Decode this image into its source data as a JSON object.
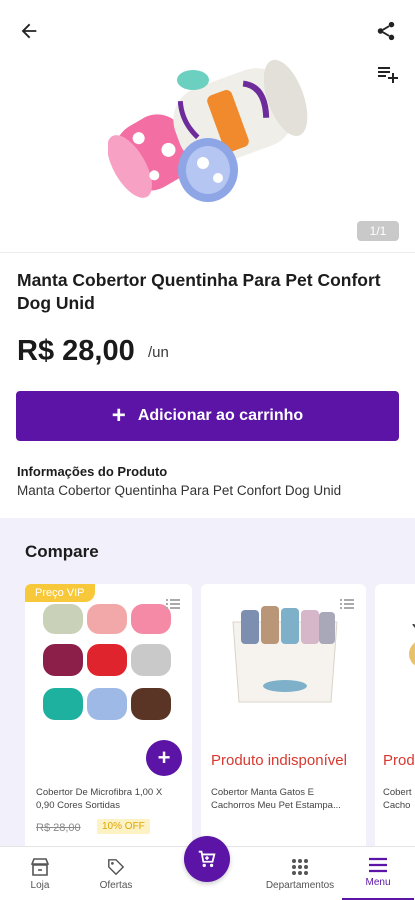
{
  "header": {
    "back_icon": "arrow-left-icon",
    "share_icon": "share-icon",
    "add_list_icon": "playlist-add-icon",
    "image_counter": "1/1"
  },
  "product": {
    "title": "Manta Cobertor Quentinha Para Pet Confort Dog Unid",
    "price": "R$ 28,00",
    "unit": "/un",
    "add_to_cart_label": "Adicionar ao carrinho",
    "info_label": "Informações do Produto",
    "info_text": "Manta Cobertor Quentinha Para Pet Confort Dog Unid"
  },
  "compare": {
    "title": "Compare",
    "cards": [
      {
        "badge": "Preço VIP",
        "name": "Cobertor De Microfibra 1,00 X 0,90 Cores Sortidas",
        "old_price": "R$ 28,00",
        "discount": "10% OFF"
      },
      {
        "status": "Produto indisponível",
        "name": "Cobertor Manta Gatos E Cachorros Meu Pet Estampa..."
      },
      {
        "status": "Prod",
        "name": "Cobert Cacho"
      }
    ]
  },
  "nav": {
    "items": [
      {
        "label": "Loja",
        "icon": "store-icon"
      },
      {
        "label": "Ofertas",
        "icon": "tag-icon"
      },
      {
        "label": "Departamentos",
        "icon": "grid-icon"
      },
      {
        "label": "Menu",
        "icon": "menu-icon"
      }
    ],
    "cart_icon": "cart-icon"
  },
  "colors": {
    "accent": "#5b14a5",
    "unavailable": "#d8382f",
    "vip": "#f7c93a",
    "compare_bg": "#f1f0fb"
  }
}
